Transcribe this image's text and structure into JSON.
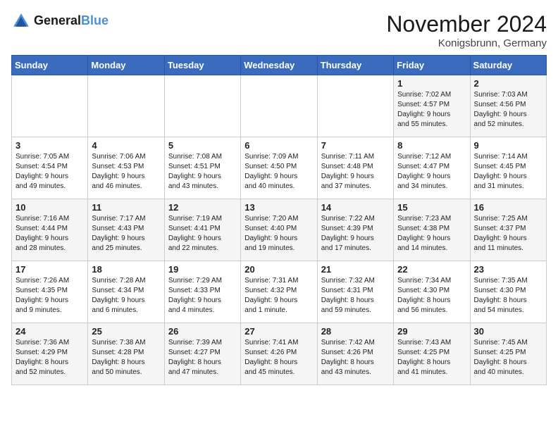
{
  "header": {
    "logo_line1": "General",
    "logo_line2": "Blue",
    "month_title": "November 2024",
    "location": "Konigsbrunn, Germany"
  },
  "weekdays": [
    "Sunday",
    "Monday",
    "Tuesday",
    "Wednesday",
    "Thursday",
    "Friday",
    "Saturday"
  ],
  "weeks": [
    [
      {
        "day": "",
        "info": ""
      },
      {
        "day": "",
        "info": ""
      },
      {
        "day": "",
        "info": ""
      },
      {
        "day": "",
        "info": ""
      },
      {
        "day": "",
        "info": ""
      },
      {
        "day": "1",
        "info": "Sunrise: 7:02 AM\nSunset: 4:57 PM\nDaylight: 9 hours\nand 55 minutes."
      },
      {
        "day": "2",
        "info": "Sunrise: 7:03 AM\nSunset: 4:56 PM\nDaylight: 9 hours\nand 52 minutes."
      }
    ],
    [
      {
        "day": "3",
        "info": "Sunrise: 7:05 AM\nSunset: 4:54 PM\nDaylight: 9 hours\nand 49 minutes."
      },
      {
        "day": "4",
        "info": "Sunrise: 7:06 AM\nSunset: 4:53 PM\nDaylight: 9 hours\nand 46 minutes."
      },
      {
        "day": "5",
        "info": "Sunrise: 7:08 AM\nSunset: 4:51 PM\nDaylight: 9 hours\nand 43 minutes."
      },
      {
        "day": "6",
        "info": "Sunrise: 7:09 AM\nSunset: 4:50 PM\nDaylight: 9 hours\nand 40 minutes."
      },
      {
        "day": "7",
        "info": "Sunrise: 7:11 AM\nSunset: 4:48 PM\nDaylight: 9 hours\nand 37 minutes."
      },
      {
        "day": "8",
        "info": "Sunrise: 7:12 AM\nSunset: 4:47 PM\nDaylight: 9 hours\nand 34 minutes."
      },
      {
        "day": "9",
        "info": "Sunrise: 7:14 AM\nSunset: 4:45 PM\nDaylight: 9 hours\nand 31 minutes."
      }
    ],
    [
      {
        "day": "10",
        "info": "Sunrise: 7:16 AM\nSunset: 4:44 PM\nDaylight: 9 hours\nand 28 minutes."
      },
      {
        "day": "11",
        "info": "Sunrise: 7:17 AM\nSunset: 4:43 PM\nDaylight: 9 hours\nand 25 minutes."
      },
      {
        "day": "12",
        "info": "Sunrise: 7:19 AM\nSunset: 4:41 PM\nDaylight: 9 hours\nand 22 minutes."
      },
      {
        "day": "13",
        "info": "Sunrise: 7:20 AM\nSunset: 4:40 PM\nDaylight: 9 hours\nand 19 minutes."
      },
      {
        "day": "14",
        "info": "Sunrise: 7:22 AM\nSunset: 4:39 PM\nDaylight: 9 hours\nand 17 minutes."
      },
      {
        "day": "15",
        "info": "Sunrise: 7:23 AM\nSunset: 4:38 PM\nDaylight: 9 hours\nand 14 minutes."
      },
      {
        "day": "16",
        "info": "Sunrise: 7:25 AM\nSunset: 4:37 PM\nDaylight: 9 hours\nand 11 minutes."
      }
    ],
    [
      {
        "day": "17",
        "info": "Sunrise: 7:26 AM\nSunset: 4:35 PM\nDaylight: 9 hours\nand 9 minutes."
      },
      {
        "day": "18",
        "info": "Sunrise: 7:28 AM\nSunset: 4:34 PM\nDaylight: 9 hours\nand 6 minutes."
      },
      {
        "day": "19",
        "info": "Sunrise: 7:29 AM\nSunset: 4:33 PM\nDaylight: 9 hours\nand 4 minutes."
      },
      {
        "day": "20",
        "info": "Sunrise: 7:31 AM\nSunset: 4:32 PM\nDaylight: 9 hours\nand 1 minute."
      },
      {
        "day": "21",
        "info": "Sunrise: 7:32 AM\nSunset: 4:31 PM\nDaylight: 8 hours\nand 59 minutes."
      },
      {
        "day": "22",
        "info": "Sunrise: 7:34 AM\nSunset: 4:30 PM\nDaylight: 8 hours\nand 56 minutes."
      },
      {
        "day": "23",
        "info": "Sunrise: 7:35 AM\nSunset: 4:30 PM\nDaylight: 8 hours\nand 54 minutes."
      }
    ],
    [
      {
        "day": "24",
        "info": "Sunrise: 7:36 AM\nSunset: 4:29 PM\nDaylight: 8 hours\nand 52 minutes."
      },
      {
        "day": "25",
        "info": "Sunrise: 7:38 AM\nSunset: 4:28 PM\nDaylight: 8 hours\nand 50 minutes."
      },
      {
        "day": "26",
        "info": "Sunrise: 7:39 AM\nSunset: 4:27 PM\nDaylight: 8 hours\nand 47 minutes."
      },
      {
        "day": "27",
        "info": "Sunrise: 7:41 AM\nSunset: 4:26 PM\nDaylight: 8 hours\nand 45 minutes."
      },
      {
        "day": "28",
        "info": "Sunrise: 7:42 AM\nSunset: 4:26 PM\nDaylight: 8 hours\nand 43 minutes."
      },
      {
        "day": "29",
        "info": "Sunrise: 7:43 AM\nSunset: 4:25 PM\nDaylight: 8 hours\nand 41 minutes."
      },
      {
        "day": "30",
        "info": "Sunrise: 7:45 AM\nSunset: 4:25 PM\nDaylight: 8 hours\nand 40 minutes."
      }
    ]
  ]
}
